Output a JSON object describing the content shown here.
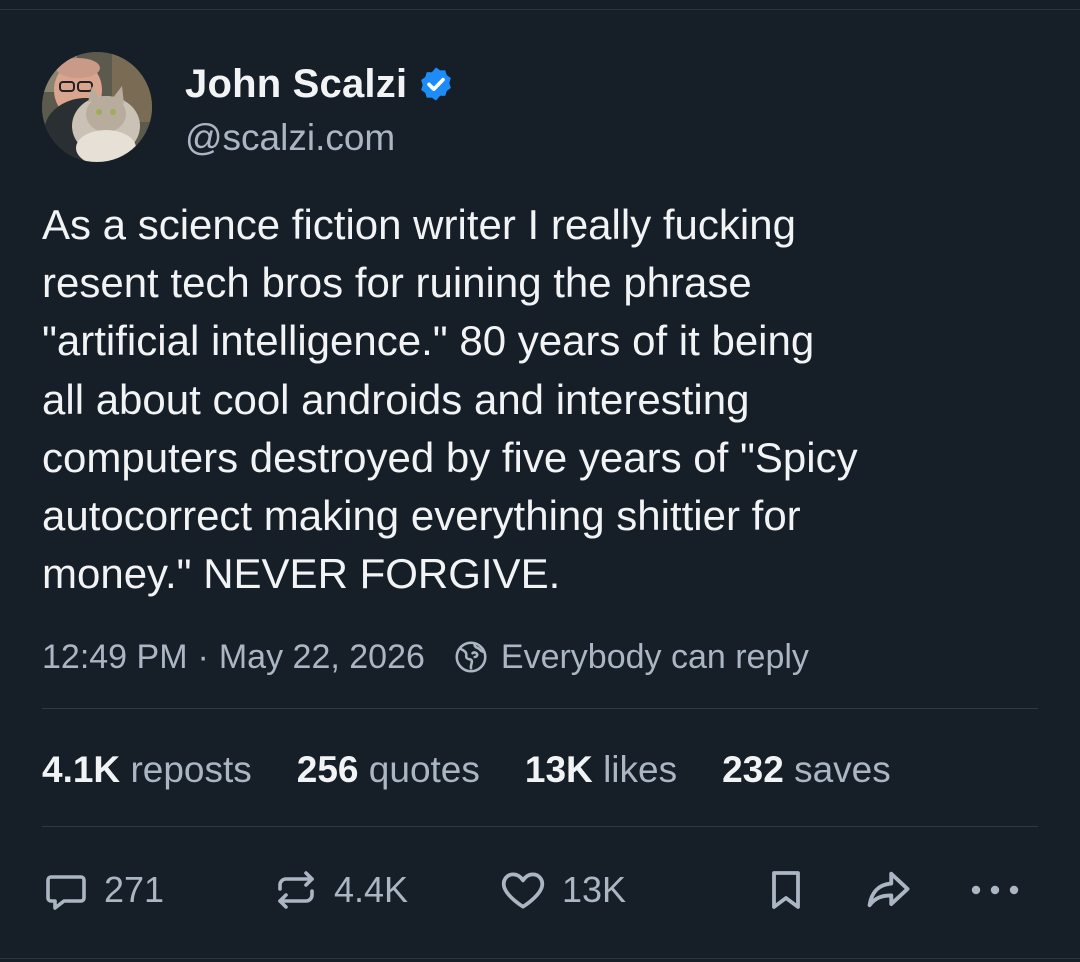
{
  "author": {
    "display_name": "John Scalzi",
    "handle": "@scalzi.com",
    "verified_icon": "verified-badge-icon",
    "brand_color": "#1d8cf8"
  },
  "post": {
    "text": "As a science fiction writer I really fucking\nresent tech bros for ruining the phrase\n\"artificial intelligence.\" 80 years of it being\nall about cool androids and interesting\ncomputers destroyed by five years of \"Spicy\nautocorrect making everything shittier for\nmoney.\" NEVER FORGIVE.",
    "time": "12:49 PM",
    "separator": "·",
    "date": "May 22, 2026",
    "reply_setting": "Everybody can reply"
  },
  "stats": [
    {
      "count": "4.1K",
      "label": "reposts"
    },
    {
      "count": "256",
      "label": "quotes"
    },
    {
      "count": "13K",
      "label": "likes"
    },
    {
      "count": "232",
      "label": "saves"
    }
  ],
  "actions": {
    "reply": {
      "icon": "reply-icon",
      "count": "271"
    },
    "repost": {
      "icon": "repost-icon",
      "count": "4.4K"
    },
    "like": {
      "icon": "heart-icon",
      "count": "13K"
    },
    "bookmark": {
      "icon": "bookmark-icon"
    },
    "share": {
      "icon": "share-icon"
    },
    "more": {
      "icon": "more-options-icon"
    }
  },
  "colors": {
    "background": "#161e27",
    "text_primary": "#f1f3f5",
    "text_secondary": "#aab6c3"
  }
}
